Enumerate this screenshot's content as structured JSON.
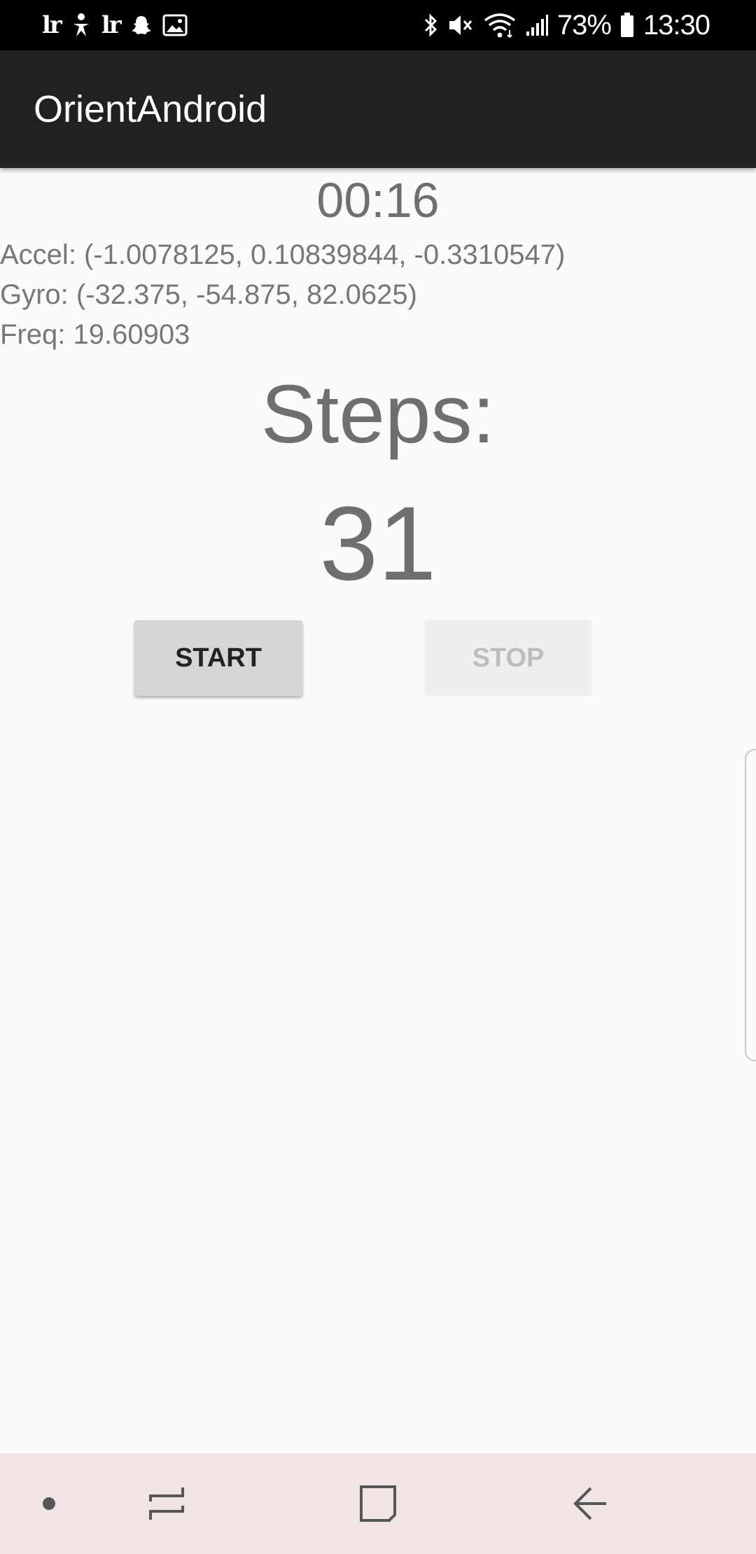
{
  "status_bar": {
    "left_icons": [
      "lightroom-icon",
      "accessibility-icon",
      "lightroom-icon",
      "snapchat-icon",
      "gallery-icon"
    ],
    "lr_glyph": "lr",
    "battery_percent": "73%",
    "time": "13:30",
    "right_icons": [
      "bluetooth-icon",
      "mute-icon",
      "wifi-icon",
      "signal-icon",
      "battery-icon"
    ]
  },
  "toolbar": {
    "title": "OrientAndroid"
  },
  "main": {
    "timer": "00:16",
    "accel": "Accel: (-1.0078125, 0.10839844, -0.3310547)",
    "gyro": "Gyro: (-32.375, -54.875, 82.0625)",
    "freq": "Freq: 19.60903",
    "steps_label": "Steps:",
    "steps_value": "31",
    "start_label": "START",
    "stop_label": "STOP"
  },
  "nav_bar": {
    "items": [
      "dot-icon",
      "recent-apps-icon",
      "home-icon",
      "back-icon"
    ]
  },
  "colors": {
    "status_bar": "#000000",
    "toolbar": "#212121",
    "background": "#fafafa",
    "nav_bar": "#f0e4e4",
    "text_gray": "#6f6f6f"
  }
}
